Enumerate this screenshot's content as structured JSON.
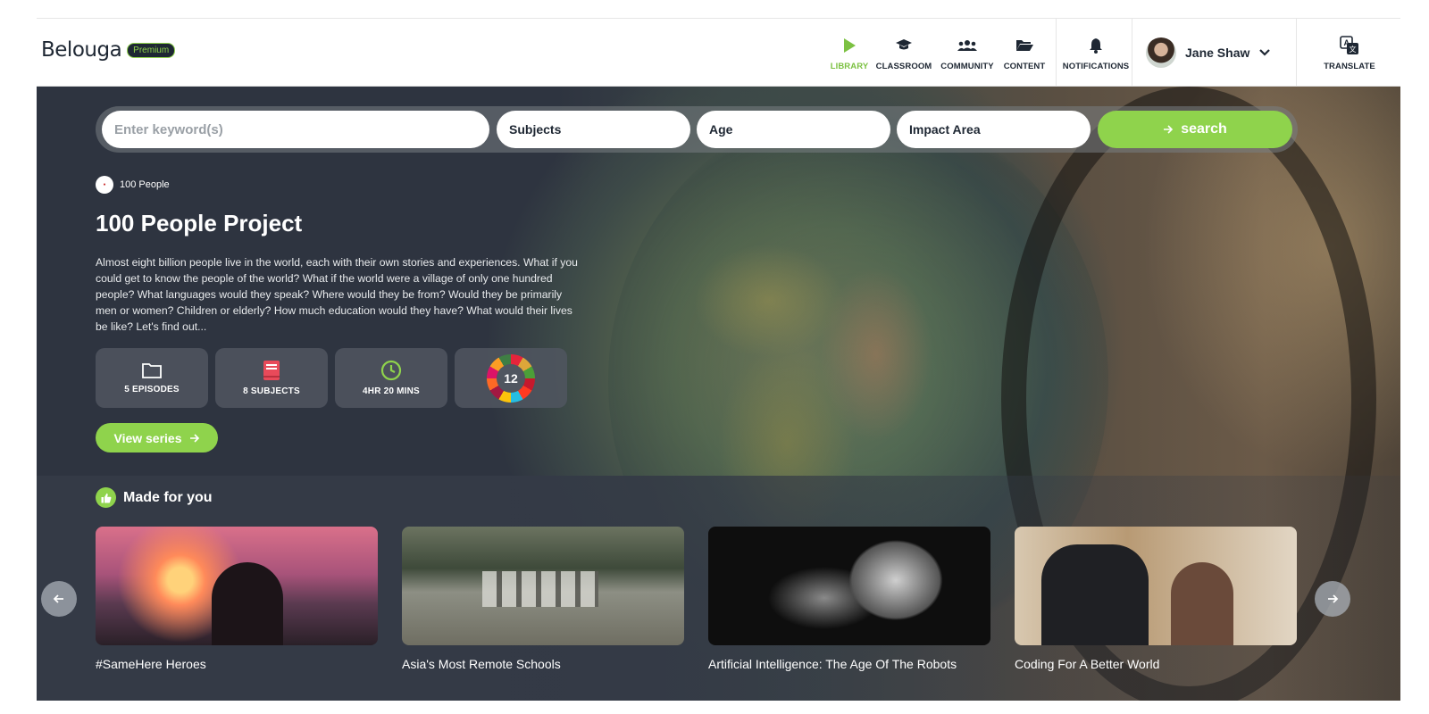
{
  "header": {
    "logo": "Belouga",
    "badge": "Premium",
    "nav": [
      {
        "label": "LIBRARY",
        "icon": "play-icon",
        "active": true
      },
      {
        "label": "CLASSROOM",
        "icon": "graduation-cap-icon",
        "active": false
      },
      {
        "label": "COMMUNITY",
        "icon": "users-icon",
        "active": false
      },
      {
        "label": "CONTENT",
        "icon": "folder-open-icon",
        "active": false
      },
      {
        "label": "NOTIFICATIONS",
        "icon": "bell-icon",
        "active": false
      }
    ],
    "user_name": "Jane Shaw",
    "translate_label": "TRANSLATE"
  },
  "search": {
    "keyword_placeholder": "Enter keyword(s)",
    "subjects": "Subjects",
    "age": "Age",
    "impact_area": "Impact Area",
    "button_label": "search"
  },
  "series": {
    "partner": "100 People",
    "title": "100 People Project",
    "description": " Almost eight billion people live in the world, each with their own stories and experiences. What if you could get to know the people of the world? What if the world were a village of only one hundred people? What languages would they speak? Where would they be from? Would they be primarily men or women? Children or elderly? How much education would they have? What would their lives be like? Let's find out...",
    "stats": [
      {
        "label": "5 EPISODES",
        "icon": "folder-icon"
      },
      {
        "label": "8 SUBJECTS",
        "icon": "book-icon"
      },
      {
        "label": "4HR 20 MINS",
        "icon": "clock-icon"
      }
    ],
    "sdg_count": "12",
    "view_label": "View series"
  },
  "made_for_you": {
    "heading": "Made for you",
    "cards": [
      {
        "title": "#SameHere Heroes"
      },
      {
        "title": "Asia's Most Remote Schools"
      },
      {
        "title": "Artificial Intelligence: The Age Of The Robots"
      },
      {
        "title": "Coding For A Better World"
      }
    ]
  },
  "colors": {
    "accent": "#8fd34c",
    "dark": "#2e3440",
    "text_dark": "#1e2733"
  }
}
